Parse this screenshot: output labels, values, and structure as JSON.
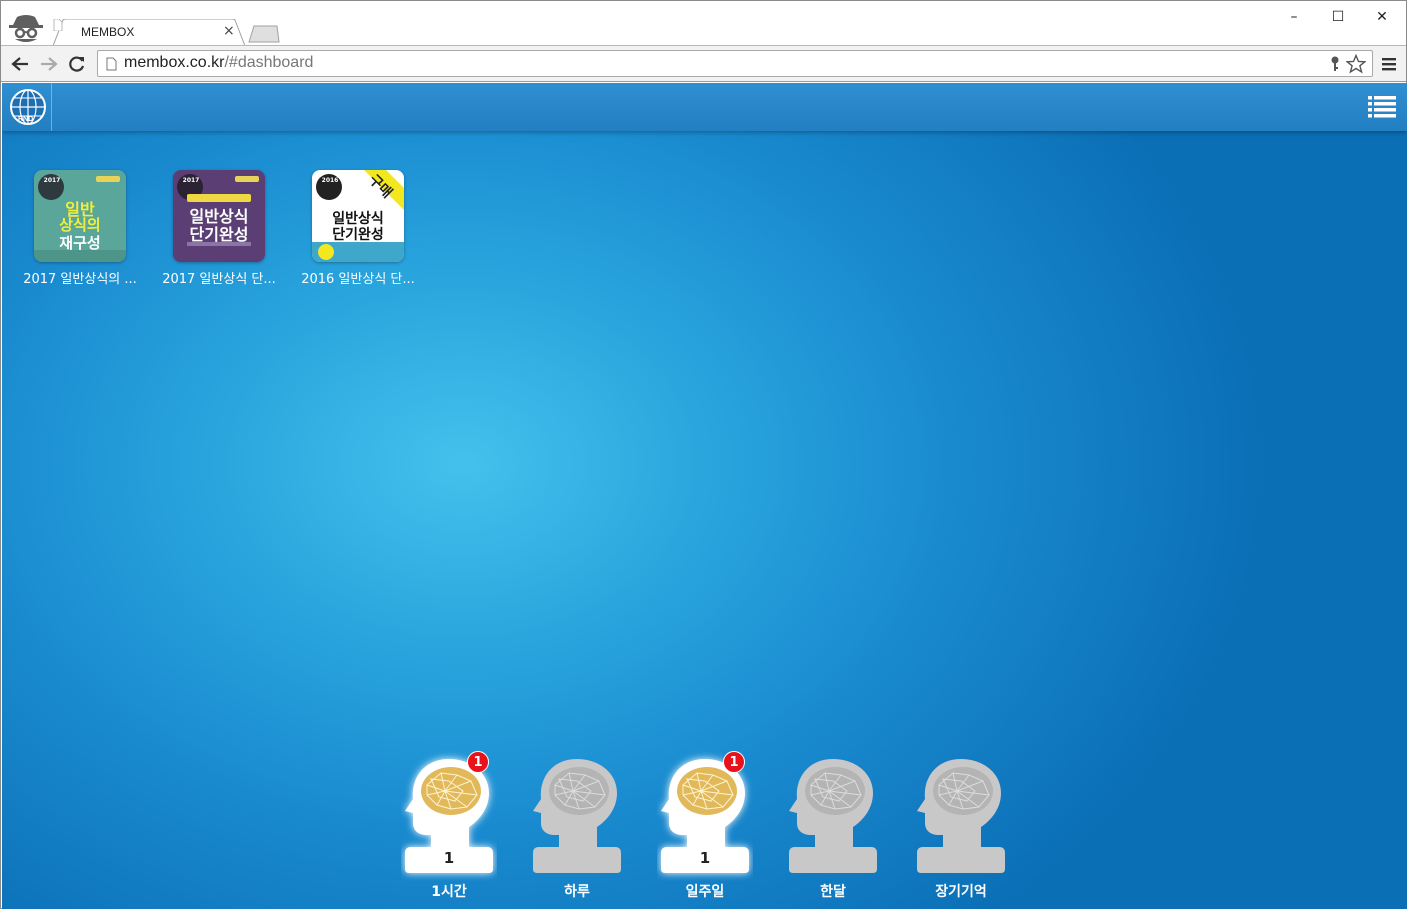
{
  "browser": {
    "tab_title": "MEMBOX",
    "tab_close": "×",
    "url_host": "membox.co.kr",
    "url_path": "/#dashboard",
    "window_controls": {
      "minimize": "–",
      "maximize": "☐",
      "close": "✕"
    }
  },
  "app": {
    "logo_text": "RND",
    "menu_icon": "list-icon"
  },
  "books": [
    {
      "title": "2017 일반상식의 ...",
      "cover": {
        "series": "2017",
        "line1": "일반",
        "line2": "상식의",
        "line3": "재구성",
        "bg": "#5aa69a"
      }
    },
    {
      "title": "2017 일반상식 단...",
      "cover": {
        "series": "2017",
        "line1": "일반상식",
        "line2": "단기완성",
        "bg": "#5b3f74"
      }
    },
    {
      "title": "2016 일반상식 단...",
      "cover": {
        "series": "2016",
        "ribbon": "구매",
        "line1": "일반상식",
        "line2": "단기완성",
        "bg": "#ffffff"
      }
    }
  ],
  "memory_stages": [
    {
      "label": "1시간",
      "count": "1",
      "badge": "1",
      "active": true
    },
    {
      "label": "하루",
      "count": "",
      "badge": "",
      "active": false
    },
    {
      "label": "일주일",
      "count": "1",
      "badge": "1",
      "active": true
    },
    {
      "label": "한달",
      "count": "",
      "badge": "",
      "active": false
    },
    {
      "label": "장기기억",
      "count": "",
      "badge": "",
      "active": false
    }
  ],
  "colors": {
    "appbar": "#2a88c9",
    "badge": "#e8121b",
    "brain_active": "#e2b95a",
    "head_inactive": "#c8c8c8"
  }
}
